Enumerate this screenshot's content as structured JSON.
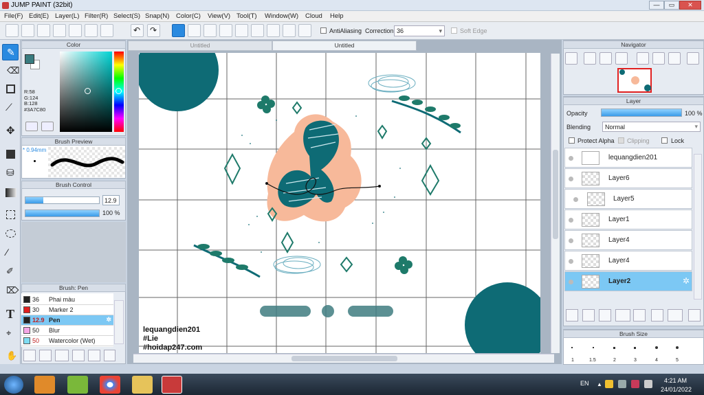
{
  "window": {
    "title": "JUMP PAINT (32bit)",
    "min": "—",
    "max": "▭",
    "close": "✕"
  },
  "menu": [
    "File(F)",
    "Edit(E)",
    "Layer(L)",
    "Filter(R)",
    "Select(S)",
    "Snap(N)",
    "Color(C)",
    "View(V)",
    "Tool(T)",
    "Window(W)",
    "Cloud",
    "Help"
  ],
  "toolbar": {
    "antialias": "AntiAliasing",
    "correction_label": "Correction",
    "correction_value": "36",
    "soft_edge": "Soft Edge"
  },
  "tabs": [
    "Untitled",
    "Untitled"
  ],
  "color": {
    "title": "Color",
    "r": "R:58",
    "g": "G:124",
    "b": "B:128",
    "hex": "#3A7C80",
    "main": "#3a7c80"
  },
  "brush_preview": {
    "title": "Brush Preview",
    "size": "0.94mm"
  },
  "brush_control": {
    "title": "Brush Control",
    "size": "12.9",
    "opacity": "100 %"
  },
  "brush_list": {
    "title": "Brush: Pen",
    "items": [
      {
        "num": "36",
        "name": "Phai màu",
        "color": "#222222"
      },
      {
        "num": "30",
        "name": "Marker 2",
        "color": "#e02020"
      },
      {
        "num": "12.9",
        "name": "Pen",
        "color": "#222222",
        "selected": true
      },
      {
        "num": "50",
        "name": "Blur",
        "color": "#f4a6e6"
      },
      {
        "num": "50",
        "name": "Watercolor (Wet)",
        "color": "#7fdcf2"
      }
    ]
  },
  "canvas": {
    "watermark": [
      "lequangdien201",
      "#Lie",
      "#hoidap247.com"
    ],
    "accent": "#0e6b75",
    "peach": "#f7b99a",
    "green": "#1e7a6a"
  },
  "navigator": {
    "title": "Navigator"
  },
  "layer_panel": {
    "title": "Layer",
    "opacity_label": "Opacity",
    "opacity_value": "100 %",
    "blending_label": "Blending",
    "blending_value": "Normal",
    "protect_alpha": "Protect Alpha",
    "clipping": "Clipping",
    "lock": "Lock",
    "layers": [
      "lequangdien201",
      "Layer6",
      "Layer5",
      "Layer1",
      "Layer4",
      "Layer4",
      "Layer2"
    ]
  },
  "brush_size": {
    "title": "Brush Size",
    "labels": [
      "1",
      "1.5",
      "2",
      "3",
      "4",
      "5"
    ]
  },
  "taskbar": {
    "lang": "EN",
    "time": "4:21 AM",
    "date": "24/01/2022"
  }
}
